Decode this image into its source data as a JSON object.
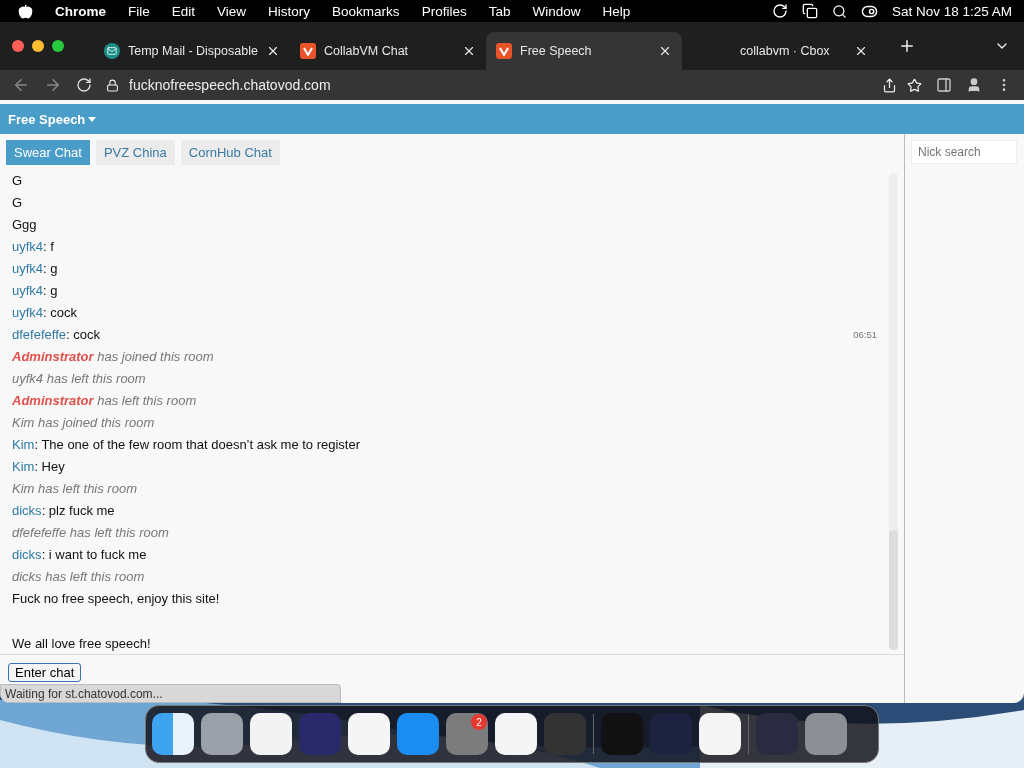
{
  "menu_bar": {
    "app": "Chrome",
    "items": [
      "File",
      "Edit",
      "View",
      "History",
      "Bookmarks",
      "Profiles",
      "Tab",
      "Window",
      "Help"
    ],
    "clock": "Sat Nov 18  1:25 AM"
  },
  "browser_tabs": [
    {
      "title": "Temp Mail - Disposable",
      "selected": false
    },
    {
      "title": "CollabVM Chat",
      "selected": false
    },
    {
      "title": "Free Speech",
      "selected": true
    },
    {
      "title": "collabvm · Cbox",
      "selected": false
    }
  ],
  "address": "fucknofreespeech.chatovod.com",
  "site": {
    "title": "Free Speech"
  },
  "rooms": [
    {
      "label": "Swear Chat",
      "selected": true
    },
    {
      "label": "PVZ China",
      "selected": false
    },
    {
      "label": "CornHub Chat",
      "selected": false
    }
  ],
  "messages": [
    {
      "kind": "plain",
      "text": "G"
    },
    {
      "kind": "plain",
      "text": "G"
    },
    {
      "kind": "plain",
      "text": "Ggg"
    },
    {
      "kind": "user",
      "nick": "uyfk4",
      "text": ": f"
    },
    {
      "kind": "user",
      "nick": "uyfk4",
      "text": ": g"
    },
    {
      "kind": "user",
      "nick": "uyfk4",
      "text": ": g"
    },
    {
      "kind": "user",
      "nick": "uyfk4",
      "text": ": cock"
    },
    {
      "kind": "user",
      "nick": "dfefefeffe",
      "text": ": cock",
      "time": "06:51"
    },
    {
      "kind": "admin",
      "nick": "Adminstrator",
      "text": " has joined this room"
    },
    {
      "kind": "system",
      "text": "uyfk4 has left this room"
    },
    {
      "kind": "admin",
      "nick": "Adminstrator",
      "text": " has left this room"
    },
    {
      "kind": "system",
      "text": "Kim has joined this room"
    },
    {
      "kind": "user",
      "nick": "Kim",
      "text": ": The one of the few room that doesn’t ask me to register"
    },
    {
      "kind": "user",
      "nick": "Kim",
      "text": ": Hey"
    },
    {
      "kind": "system",
      "text": "Kim has left this room"
    },
    {
      "kind": "user",
      "nick": "dicks",
      "text": ": plz fuck me"
    },
    {
      "kind": "system",
      "text": "dfefefeffe has left this room"
    },
    {
      "kind": "user",
      "nick": "dicks",
      "text": ": i want to fuck me"
    },
    {
      "kind": "system",
      "text": "dicks has left this room"
    },
    {
      "kind": "plain",
      "text": "Fuck no free speech, enjoy this site!"
    },
    {
      "kind": "gap"
    },
    {
      "kind": "plain",
      "text": "We all love free speech!"
    }
  ],
  "enter_button": "Enter chat",
  "status": "Waiting for st.chatovod.com...",
  "nick_search": {
    "placeholder": "Nick search"
  },
  "dock": {
    "badge": "2"
  }
}
